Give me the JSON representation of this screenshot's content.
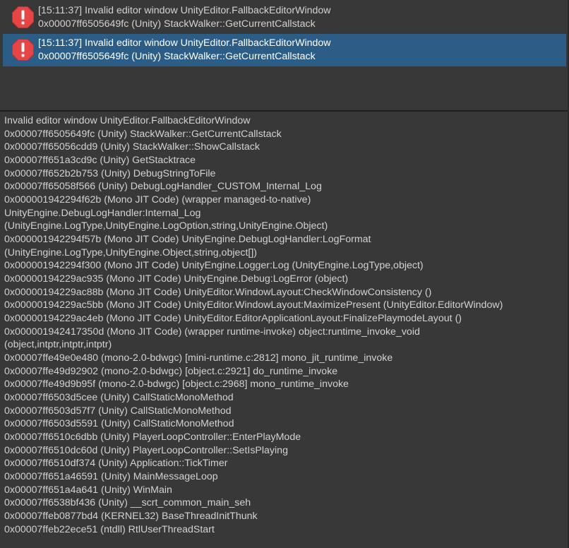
{
  "console": {
    "entries": [
      {
        "icon": "error-icon",
        "line1": "[15:11:37] Invalid editor window UnityEditor.FallbackEditorWindow",
        "line2": "0x00007ff6505649fc (Unity) StackWalker::GetCurrentCallstack",
        "selected": false
      },
      {
        "icon": "error-icon",
        "line1": "[15:11:37] Invalid editor window UnityEditor.FallbackEditorWindow",
        "line2": "0x00007ff6505649fc (Unity) StackWalker::GetCurrentCallstack",
        "selected": true
      }
    ],
    "colors": {
      "background": "#383838",
      "selected": "#2c5d87",
      "error_icon": "#e64545"
    },
    "detail_lines": [
      "Invalid editor window UnityEditor.FallbackEditorWindow",
      "0x00007ff6505649fc (Unity) StackWalker::GetCurrentCallstack",
      "0x00007ff65056cdd9 (Unity) StackWalker::ShowCallstack",
      "0x00007ff651a3cd9c (Unity) GetStacktrace",
      "0x00007ff652b2b753 (Unity) DebugStringToFile",
      "0x00007ff65058f566 (Unity) DebugLogHandler_CUSTOM_Internal_Log",
      "0x000001942294f62b (Mono JIT Code) (wrapper managed-to-native)",
      "UnityEngine.DebugLogHandler:Internal_Log",
      "(UnityEngine.LogType,UnityEngine.LogOption,string,UnityEngine.Object)",
      "0x000001942294f57b (Mono JIT Code) UnityEngine.DebugLogHandler:LogFormat",
      "(UnityEngine.LogType,UnityEngine.Object,string,object[])",
      "0x000001942294f300 (Mono JIT Code) UnityEngine.Logger:Log (UnityEngine.LogType,object)",
      "0x00000194229ac935 (Mono JIT Code) UnityEngine.Debug:LogError (object)",
      "0x00000194229ac88b (Mono JIT Code) UnityEditor.WindowLayout:CheckWindowConsistency ()",
      "0x00000194229ac5bb (Mono JIT Code) UnityEditor.WindowLayout:MaximizePresent (UnityEditor.EditorWindow)",
      "0x00000194229ac4eb (Mono JIT Code) UnityEditor.EditorApplicationLayout:FinalizePlaymodeLayout ()",
      "0x000001942417350d (Mono JIT Code) (wrapper runtime-invoke) object:runtime_invoke_void",
      "(object,intptr,intptr,intptr)",
      "0x00007ffe49e0e480 (mono-2.0-bdwgc) [mini-runtime.c:2812] mono_jit_runtime_invoke",
      "0x00007ffe49d92902 (mono-2.0-bdwgc) [object.c:2921] do_runtime_invoke",
      "0x00007ffe49d9b95f (mono-2.0-bdwgc) [object.c:2968] mono_runtime_invoke",
      "0x00007ff6503d5cee (Unity) CallStaticMonoMethod",
      "0x00007ff6503d57f7 (Unity) CallStaticMonoMethod",
      "0x00007ff6503d5591 (Unity) CallStaticMonoMethod",
      "0x00007ff6510c6dbb (Unity) PlayerLoopController::EnterPlayMode",
      "0x00007ff6510dc60d (Unity) PlayerLoopController::SetIsPlaying",
      "0x00007ff6510df374 (Unity) Application::TickTimer",
      "0x00007ff651a46591 (Unity) MainMessageLoop",
      "0x00007ff651a4a641 (Unity) WinMain",
      "0x00007ff6538bf436 (Unity) __scrt_common_main_seh",
      "0x00007ffeb0877bd4 (KERNEL32) BaseThreadInitThunk",
      "0x00007ffeb22ece51 (ntdll) RtlUserThreadStart"
    ]
  }
}
